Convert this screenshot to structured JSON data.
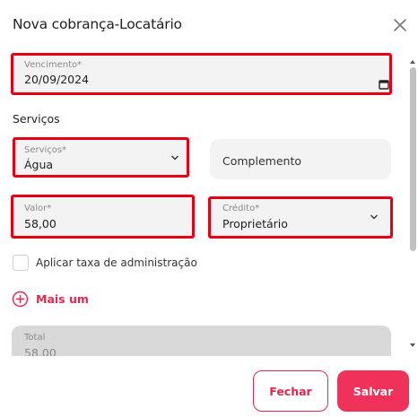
{
  "dialog": {
    "title": "Nova cobrança-Locatário",
    "close_icon": "close-icon"
  },
  "form": {
    "vencimento": {
      "label": "Vencimento",
      "required_mark": "*",
      "value": "20/09/2024",
      "icon": "calendar-icon"
    },
    "section_title": "Serviços",
    "servicos": {
      "label": "Serviços",
      "required_mark": "*",
      "value": "Água",
      "icon": "chevron-down-icon"
    },
    "complemento": {
      "placeholder": "Complemento"
    },
    "valor": {
      "label": "Valor",
      "required_mark": "*",
      "value": "58,00"
    },
    "credito": {
      "label": "Crédito",
      "required_mark": "*",
      "value": "Proprietário",
      "icon": "chevron-down-icon"
    },
    "taxa_checkbox": {
      "label": "Aplicar taxa de administração",
      "checked": false
    },
    "add_more": {
      "label": "Mais um",
      "icon": "plus-circle-icon"
    },
    "total": {
      "label": "Total",
      "value": "58,00"
    }
  },
  "footer": {
    "close_label": "Fechar",
    "save_label": "Salvar"
  },
  "colors": {
    "accent": "#e8264c",
    "highlight": "#e60012",
    "field_bg": "#f3f3f3",
    "disabled_bg": "#d9d9d9"
  }
}
